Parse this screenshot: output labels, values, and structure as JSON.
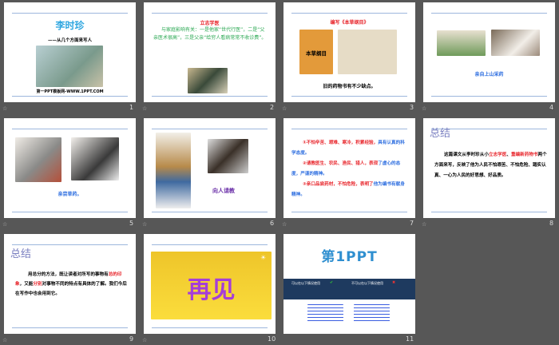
{
  "slides": [
    {
      "number": "1",
      "title": "李时珍",
      "subtitle": "——从几个方面来写人",
      "footer": "第一PPT模板网-WWW.1PPT.COM"
    },
    {
      "number": "2",
      "heading": "立志学医",
      "body": "与家庭影响有关：一是他家“世代行医”，二是“父亲医术很高”，三是父亲“给穷人看病常常不收诊费”。"
    },
    {
      "number": "3",
      "heading": "编写《本草纲目》",
      "book_title": "本草纲目",
      "caption": "旧的药物书有不少缺点。"
    },
    {
      "number": "4",
      "caption": "亲自上山采药"
    },
    {
      "number": "5",
      "caption": "亲尝草药。"
    },
    {
      "number": "6",
      "caption": "向人请教"
    },
    {
      "number": "7",
      "points": [
        {
          "red": "①不怕辛苦、艰难、寒冷，积累经验，",
          "blue": "具有认真的科学态度。"
        },
        {
          "red": "②请教医生、农民、渔民、猎人，表现",
          "blue": "了虚心的态度，严谨的精神。"
        },
        {
          "red": "③亲口品尝药材，不怕危险，表明了",
          "blue": "他为编书有献身精神。"
        }
      ]
    },
    {
      "number": "8",
      "heading": "总结",
      "p1": "这篇课文从李时珍从小",
      "h1": "立志学医",
      "p2": "、",
      "h2": "重编新药物书",
      "p3": "两个方面来写，反映了他为人民不怕艰苦、不怕危险、踏实认真、一心为人民的好思想、好品质。"
    },
    {
      "number": "9",
      "heading": "总结",
      "p1": "用总分的方法，既让读者对所写的事物有",
      "h1": "总的印象",
      "p2": "，又能",
      "h2": "分别",
      "p3": "对事物不同的特点有具体的了解。我们今后在写作中也会用到它。"
    },
    {
      "number": "10",
      "text": "再见"
    },
    {
      "number": "11",
      "logo": "第1PPT",
      "can_use": "可以在以下情况使用",
      "cannot_use": "不可以在以下情况使用"
    }
  ],
  "colors": {
    "background": "#575757",
    "accent_red": "#e8262c",
    "accent_blue": "#2f6fe0"
  }
}
